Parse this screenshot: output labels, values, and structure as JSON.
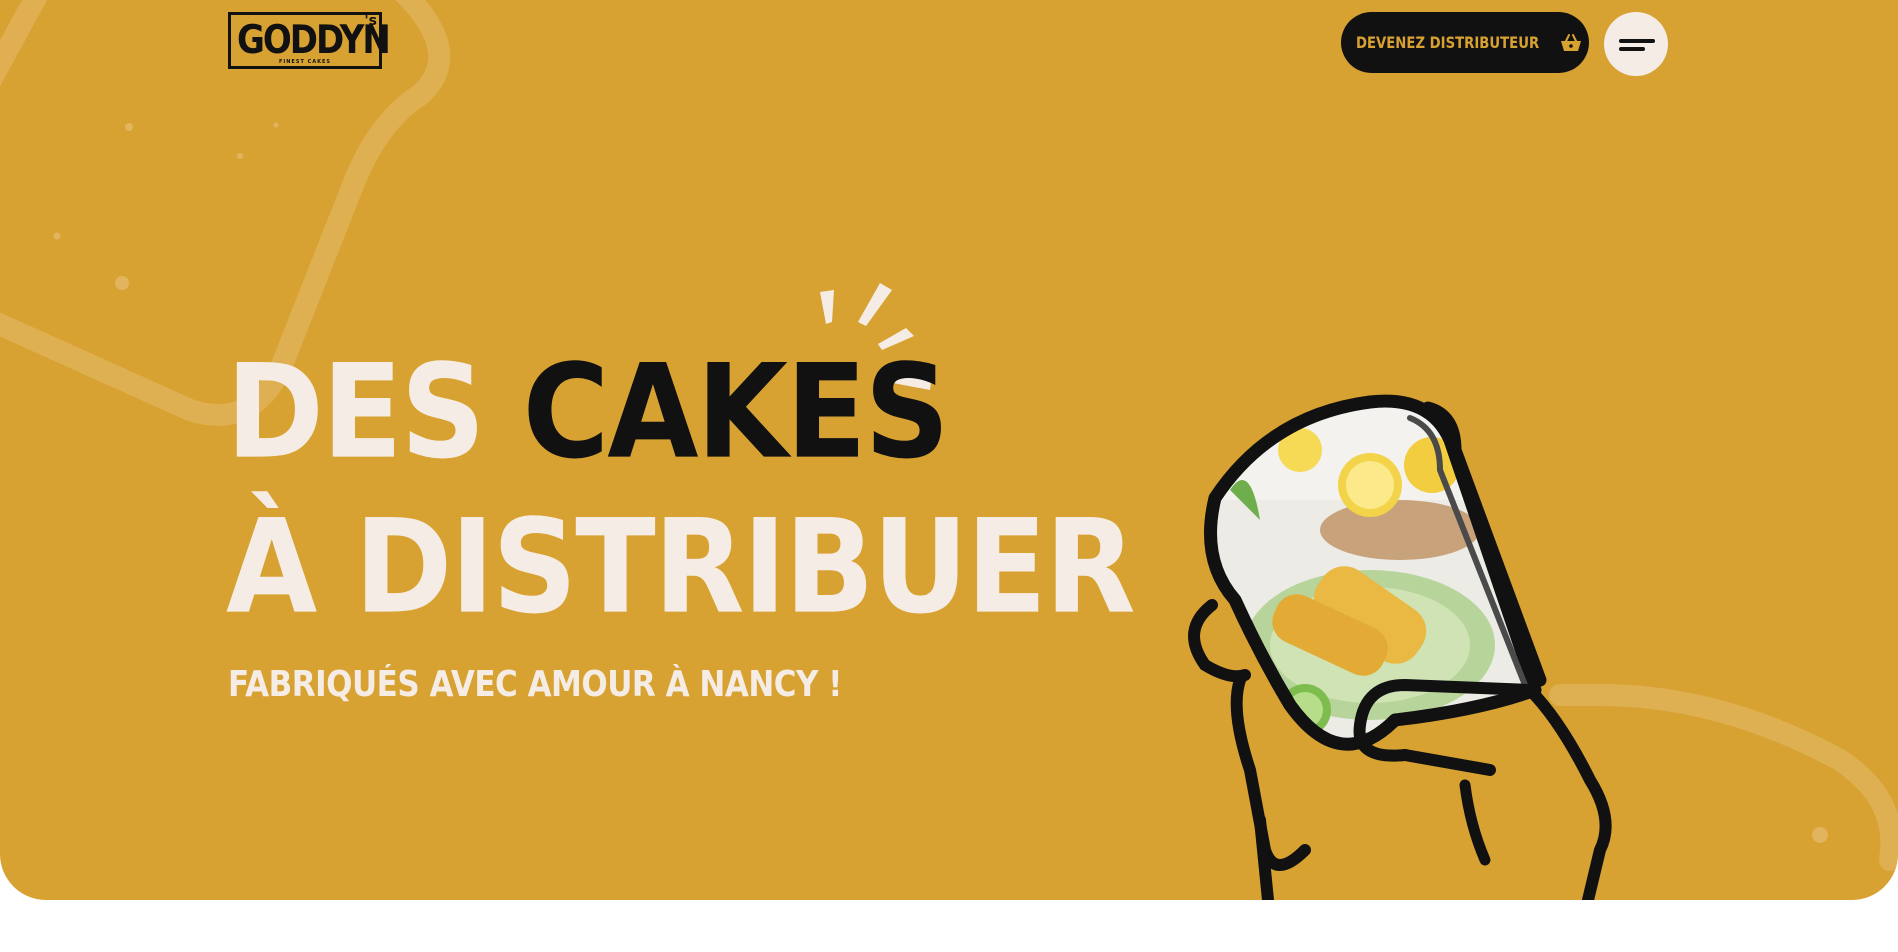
{
  "brand": {
    "name": "GODDYN",
    "apostrophe": "'s",
    "tagline": "FINEST CAKES"
  },
  "header": {
    "cta_label": "DEVENEZ DISTRIBUTEUR",
    "cta_icon": "basket-icon",
    "menu_icon": "menu-icon"
  },
  "hero": {
    "title_word1": "DES",
    "title_word2": "CAKES",
    "title_line2": "À DISTRIBUER",
    "subtitle": "FABRIQUÉS AVEC AMOUR À NANCY !",
    "illustration": "hand-holding-cake-slice-illustration"
  },
  "colors": {
    "background": "#d8a233",
    "cream": "#f5ede5",
    "dark": "#111111",
    "page": "#ffffff"
  }
}
